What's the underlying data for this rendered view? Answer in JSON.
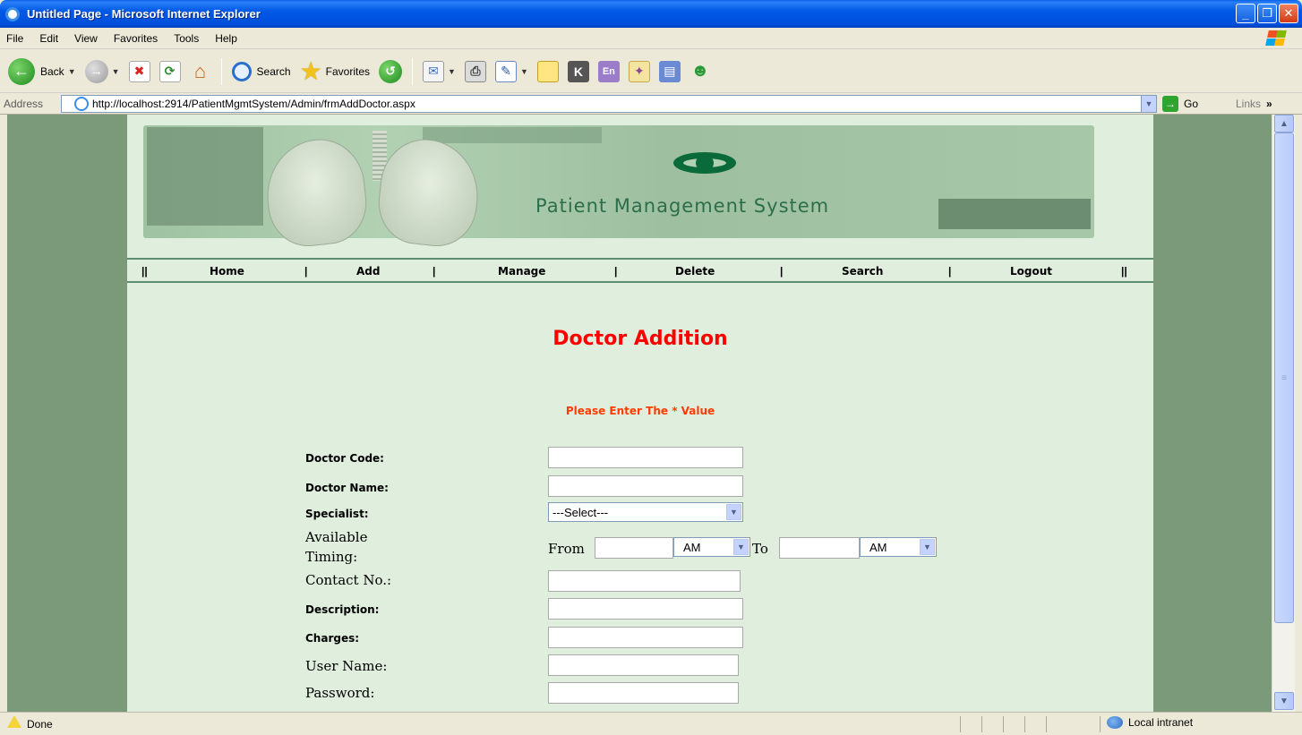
{
  "window": {
    "title": "Untitled Page - Microsoft Internet Explorer",
    "min_glyph": "_",
    "max_glyph": "❐",
    "close_glyph": "✕"
  },
  "menu": [
    "File",
    "Edit",
    "View",
    "Favorites",
    "Tools",
    "Help"
  ],
  "toolbar": {
    "back_label": "Back",
    "search_label": "Search",
    "favorites_label": "Favorites"
  },
  "address": {
    "label": "Address",
    "url": "http://localhost:2914/PatientMgmtSystem/Admin/frmAddDoctor.aspx",
    "go_label": "Go",
    "links_label": "Links"
  },
  "page": {
    "banner_title": "Patient Management System",
    "nav": {
      "sep": "||",
      "pipe": "|",
      "items": [
        "Home",
        "Add",
        "Manage",
        "Delete",
        "Search",
        "Logout"
      ]
    },
    "heading": "Doctor Addition",
    "required_note": "Please Enter The * Value",
    "form": {
      "doctor_code_label": "Doctor Code:",
      "doctor_name_label": "Doctor Name:",
      "specialist_label": "Specialist:",
      "specialist_value": "---Select---",
      "available_label_line1": "Available",
      "available_label_line2": "Timing:",
      "from_label": "From",
      "from_ampm": "AM",
      "to_label": "To",
      "to_ampm": "AM",
      "contact_label": "Contact No.:",
      "description_label": "Description:",
      "charges_label": "Charges:",
      "username_label": "User Name:",
      "password_label": "Password:"
    }
  },
  "status": {
    "text": "Done",
    "zone": "Local intranet"
  },
  "colors": {
    "page_background": "#dfeedd",
    "side_background": "#7a9a7a",
    "heading_red": "#ff0000",
    "note_red": "#ff3c00",
    "nav_border": "#5f8f73"
  }
}
